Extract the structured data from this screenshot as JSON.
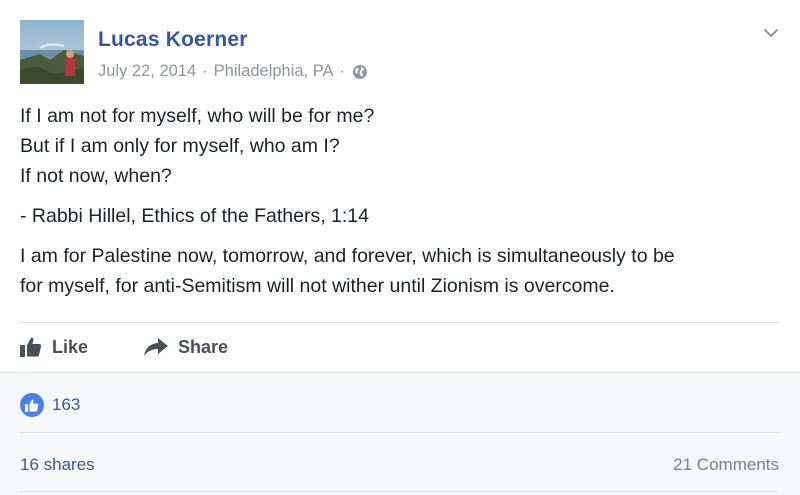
{
  "post": {
    "author": "Lucas Koerner",
    "date": "July 22, 2014",
    "location": "Philadelphia, PA",
    "separator": "·",
    "privacy_icon": "globe-icon",
    "menu_icon": "chevron-down-icon",
    "text_lines": [
      "If I am not for myself, who will be for me?",
      "But if I am only for myself, who am I?",
      "If not now, when?"
    ],
    "attribution": "- Rabbi Hillel, Ethics of the Fathers, 1:14",
    "statement_lines": [
      "I am for Palestine now, tomorrow, and forever, which is simultaneously to be",
      "for myself, for anti-Semitism will not wither until Zionism is overcome."
    ]
  },
  "actions": {
    "like_label": "Like",
    "share_label": "Share"
  },
  "stats": {
    "reaction_count": "163",
    "shares": "16 shares",
    "comments": "21 Comments"
  },
  "colors": {
    "link": "#365899",
    "meta": "#90949c",
    "text": "#1d2129",
    "like_badge": "#4a80e8"
  }
}
